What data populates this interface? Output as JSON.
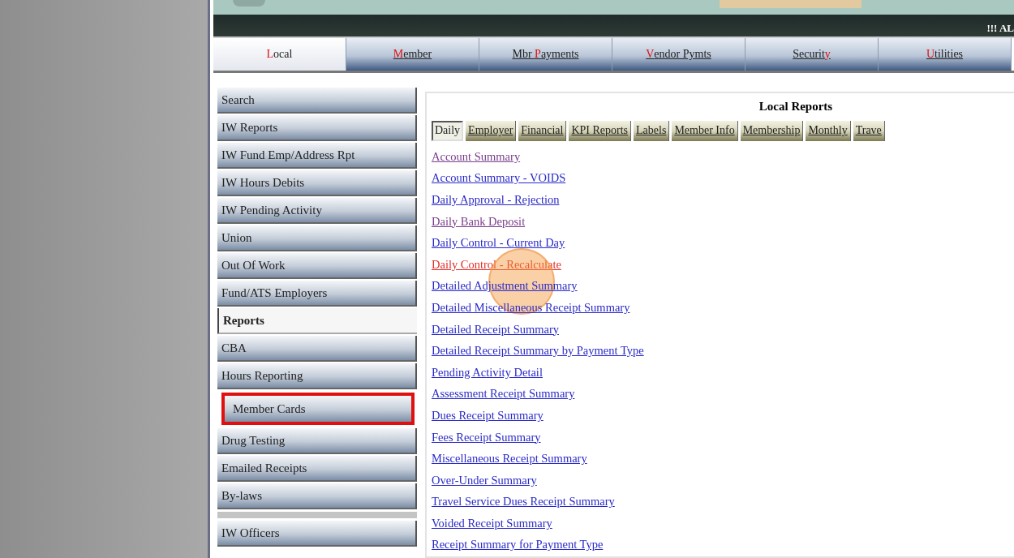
{
  "header": {
    "alert": "!!! AL"
  },
  "nav_tabs": [
    {
      "key": "L",
      "after": "ocal",
      "selected": true
    },
    {
      "key": "M",
      "after": "ember",
      "selected": false
    },
    {
      "before": "Mbr ",
      "key": "P",
      "after": "ayments",
      "selected": false
    },
    {
      "key": "V",
      "after": "endor Pymts",
      "selected": false
    },
    {
      "before": "Securit",
      "key": "y",
      "selected": false
    },
    {
      "key": "U",
      "after": "tilities",
      "selected": false
    }
  ],
  "sidebar": {
    "items": [
      {
        "label": "Search",
        "selected": false,
        "highlighted": false
      },
      {
        "label": "IW Reports",
        "selected": false,
        "highlighted": false
      },
      {
        "label": "IW Fund Emp/Address Rpt",
        "selected": false,
        "highlighted": false
      },
      {
        "label": "IW Hours Debits",
        "selected": false,
        "highlighted": false
      },
      {
        "label": "IW Pending Activity",
        "selected": false,
        "highlighted": false
      },
      {
        "label": "Union",
        "selected": false,
        "highlighted": false
      },
      {
        "label": "Out Of Work",
        "selected": false,
        "highlighted": false
      },
      {
        "label": "Fund/ATS Employers",
        "selected": false,
        "highlighted": false
      },
      {
        "label": "Reports",
        "selected": true,
        "highlighted": false
      },
      {
        "label": "CBA",
        "selected": false,
        "highlighted": false
      },
      {
        "label": "Hours Reporting",
        "selected": false,
        "highlighted": false
      },
      {
        "label": "Member Cards",
        "selected": false,
        "highlighted": true
      },
      {
        "label": "Drug Testing",
        "selected": false,
        "highlighted": false
      },
      {
        "label": "Emailed Receipts",
        "selected": false,
        "highlighted": false
      },
      {
        "label": "By-laws",
        "selected": false,
        "highlighted": false
      },
      {
        "label": "IW Officers",
        "selected": false,
        "highlighted": false
      }
    ]
  },
  "reports": {
    "title": "Local Reports",
    "tabs": [
      {
        "label": "Daily",
        "selected": true
      },
      {
        "label": "Employer",
        "selected": false
      },
      {
        "label": "Financial",
        "selected": false
      },
      {
        "label": "KPI Reports",
        "selected": false
      },
      {
        "label": "Labels",
        "selected": false
      },
      {
        "label": "Member Info",
        "selected": false
      },
      {
        "label": "Membership",
        "selected": false
      },
      {
        "label": "Monthly",
        "selected": false
      },
      {
        "label": "Trave",
        "selected": false
      }
    ],
    "links": [
      {
        "label": "Account Summary",
        "kind": "visited"
      },
      {
        "label": "Account Summary - VOIDS",
        "kind": "unvisited"
      },
      {
        "label": "Daily Approval - Rejection",
        "kind": "unvisited"
      },
      {
        "label": "Daily Bank Deposit",
        "kind": "visited"
      },
      {
        "label": "Daily Control - Current Day",
        "kind": "unvisited"
      },
      {
        "label": "Daily Control - Recalculate",
        "kind": "hover"
      },
      {
        "label": "Detailed Adjustment Summary",
        "kind": "unvisited"
      },
      {
        "label": "Detailed Miscellaneous Receipt Summary",
        "kind": "unvisited"
      },
      {
        "label": "Detailed Receipt Summary",
        "kind": "unvisited"
      },
      {
        "label": "Detailed Receipt Summary by Payment Type",
        "kind": "unvisited"
      },
      {
        "label": "Pending Activity Detail",
        "kind": "unvisited"
      },
      {
        "label": "Assessment Receipt Summary",
        "kind": "unvisited"
      },
      {
        "label": "Dues Receipt Summary",
        "kind": "unvisited"
      },
      {
        "label": "Fees Receipt Summary",
        "kind": "unvisited"
      },
      {
        "label": "Miscellaneous Receipt Summary",
        "kind": "unvisited"
      },
      {
        "label": "Over-Under Summary",
        "kind": "unvisited"
      },
      {
        "label": "Travel Service Dues Receipt Summary",
        "kind": "unvisited"
      },
      {
        "label": "Voided Receipt Summary",
        "kind": "unvisited"
      },
      {
        "label": "Receipt Summary for Payment Type",
        "kind": "unvisited"
      }
    ]
  }
}
